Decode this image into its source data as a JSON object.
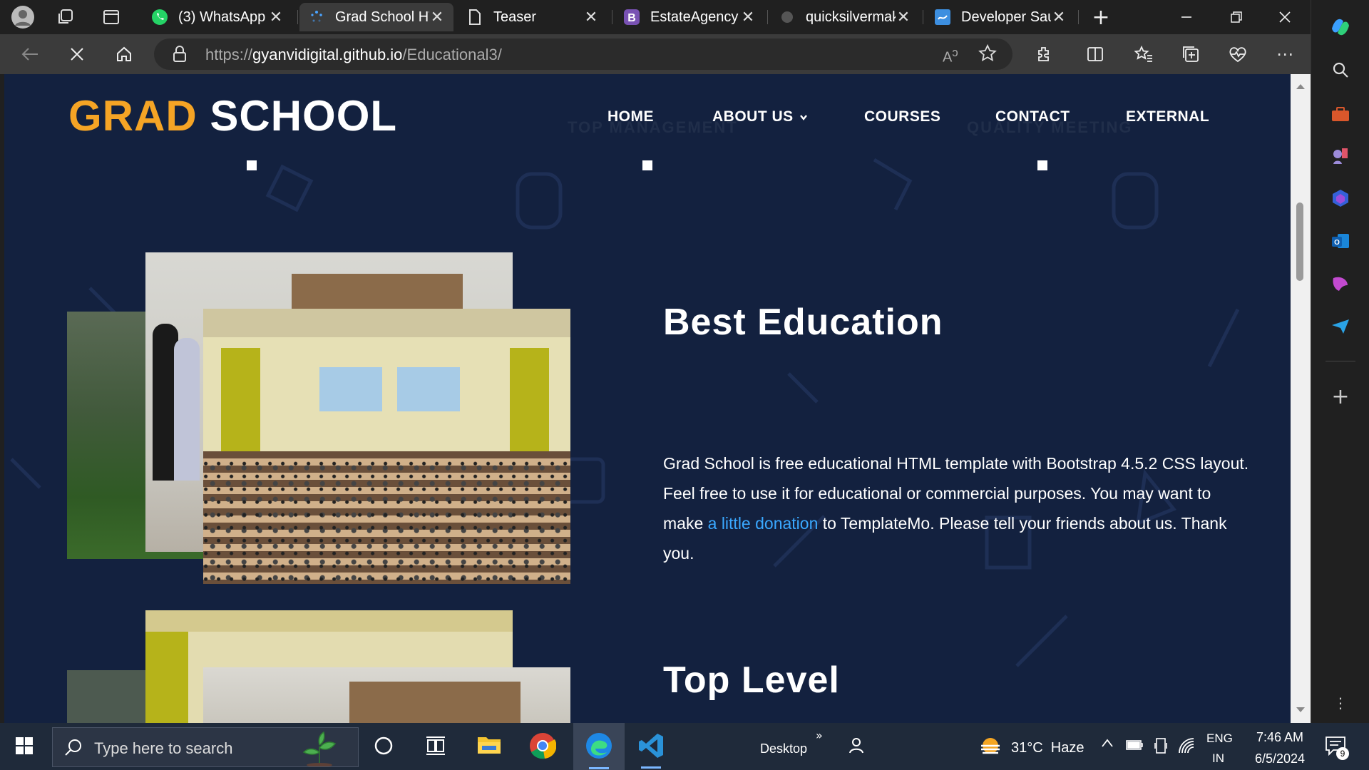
{
  "browser": {
    "tabs": [
      {
        "label": "(3) WhatsApp",
        "icon": "whatsapp-icon"
      },
      {
        "label": "Grad School HTML",
        "icon": "loading-icon"
      },
      {
        "label": "Teaser",
        "icon": "page-icon"
      },
      {
        "label": "EstateAgency B",
        "icon": "bootstrap-icon"
      },
      {
        "label": "quicksilvermak",
        "icon": "github-icon"
      },
      {
        "label": "Developer Saur",
        "icon": "site-icon"
      }
    ],
    "url_scheme": "https://",
    "url_host": "gyanvidigital.github.io",
    "url_path": "/Educational3/"
  },
  "site": {
    "logo_part1": "GRAD",
    "logo_part2": "SCHOOL",
    "nav": [
      {
        "label": "HOME"
      },
      {
        "label": "ABOUT US"
      },
      {
        "label": "COURSES"
      },
      {
        "label": "CONTACT"
      },
      {
        "label": "EXTERNAL"
      }
    ],
    "ghost_text_1": "TOP MANAGEMENT",
    "ghost_text_2": "QUALITY MEETING",
    "section1": {
      "heading": "Best Education",
      "text_before": "Grad School is free educational HTML template with Bootstrap 4.5.2 CSS layout. Feel free to use it for educational or commercial purposes. You may want to make ",
      "link": "a little donation",
      "text_after": " to TemplateMo. Please tell your friends about us. Thank you."
    },
    "section2": {
      "heading": "Top Level"
    }
  },
  "taskbar": {
    "search_placeholder": "Type here to search",
    "desktop_label": "Desktop",
    "weather": "31°C  Haze",
    "lang_1": "ENG",
    "lang_2": "IN",
    "time": "7:46 AM",
    "date": "6/5/2024",
    "notification_count": "9"
  },
  "colors": {
    "page_bg": "#13213f",
    "logo_accent": "#f5a425",
    "link": "#3aa8ff"
  }
}
